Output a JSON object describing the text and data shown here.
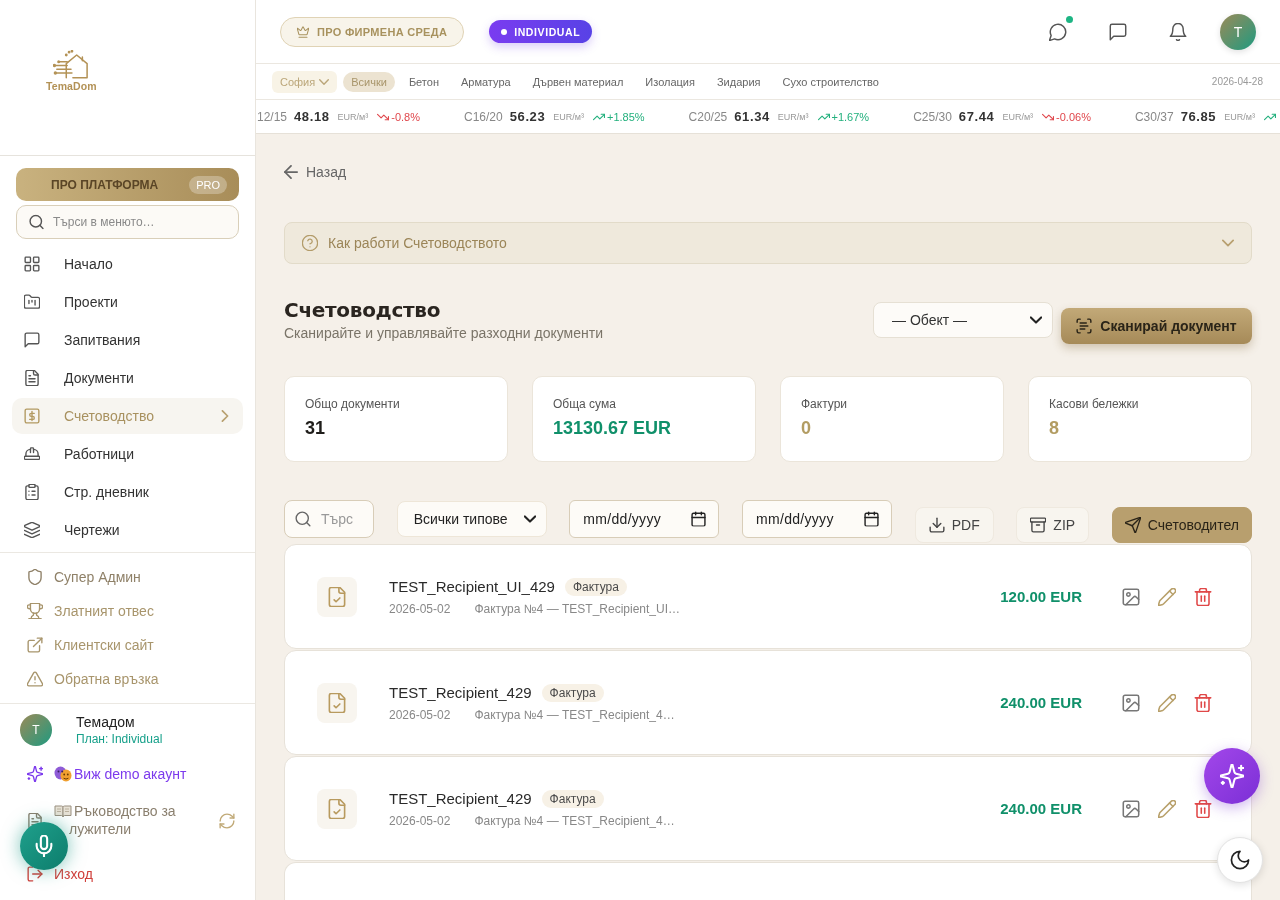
{
  "sidebar": {
    "logo": "TemaDom",
    "pro_button": {
      "label": "ПРО ПЛАТФОРМА",
      "badge": "PRO"
    },
    "search": {
      "placeholder": "Търси в менюто…"
    },
    "nav_items": [
      {
        "label": "Начало",
        "selected": false
      },
      {
        "label": "Проекти",
        "selected": false
      },
      {
        "label": "Запитвания",
        "selected": false
      },
      {
        "label": "Документи",
        "selected": false
      },
      {
        "label": "Счетоводство",
        "selected": true
      },
      {
        "label": "Работници",
        "selected": false
      },
      {
        "label": "Стр. дневник",
        "selected": false
      },
      {
        "label": "Чертежи",
        "selected": false
      }
    ],
    "admin_links": [
      {
        "label": "Супер Админ"
      },
      {
        "label": "Златният отвес"
      },
      {
        "label": "Клиентски сайт"
      },
      {
        "label": "Обратна връзка"
      }
    ],
    "user": {
      "initial": "T",
      "name": "Темадом",
      "plan": "План: Individual"
    },
    "footer_links": [
      {
        "kind": "demo",
        "label": "Виж demo акаунт"
      },
      {
        "kind": "guide",
        "label": "Ръководство за лужители"
      },
      {
        "kind": "logout",
        "label": "Изход"
      }
    ]
  },
  "header": {
    "badges": [
      {
        "kind": "pro",
        "label": "ПРО ФИРМЕНА СРЕДА"
      },
      {
        "kind": "plan",
        "label": "INDIVIDUAL"
      }
    ],
    "chat_unread": true,
    "avatar": "T"
  },
  "category_bar": {
    "city": "София",
    "categories": [
      {
        "label": "Всички",
        "selected": true
      },
      {
        "label": "Бетон",
        "selected": false
      },
      {
        "label": "Арматура",
        "selected": false
      },
      {
        "label": "Дървен материал",
        "selected": false
      },
      {
        "label": "Изолация",
        "selected": false
      },
      {
        "label": "Зидария",
        "selected": false
      },
      {
        "label": "Сухо строителство",
        "selected": false
      }
    ],
    "date": "2026-04-28"
  },
  "ticker": [
    {
      "grade": "12/15",
      "price": "48.18",
      "unit": "EUR/м³",
      "rising": false,
      "change": "-0.8%"
    },
    {
      "grade": "C16/20",
      "price": "56.23",
      "unit": "EUR/м³",
      "rising": true,
      "change": "+1.85%"
    },
    {
      "grade": "C20/25",
      "price": "61.34",
      "unit": "EUR/м³",
      "rising": true,
      "change": "+1.67%"
    },
    {
      "grade": "C25/30",
      "price": "67.44",
      "unit": "EUR/м³",
      "rising": false,
      "change": "-0.06%"
    },
    {
      "grade": "C30/37",
      "price": "76.85",
      "unit": "EUR/м³",
      "rising": true
    }
  ],
  "back_link": "Назад",
  "help_panel": {
    "title": "Как работи Счетоводството",
    "expanded": false
  },
  "page": {
    "title": "Счетоводство",
    "subtitle": "Сканирайте и управлявайте разходни документи",
    "object_select": "— Обект —",
    "scan_button": "Сканирай документ"
  },
  "stats": [
    {
      "label": "Общо документи",
      "value": "31",
      "color": "#1f1d1a"
    },
    {
      "label": "Обща сума",
      "value": "13130.67 EUR",
      "color": "#10906a"
    },
    {
      "label": "Фактури",
      "value": "0",
      "color": "#b29c62"
    },
    {
      "label": "Касови бележки",
      "value": "8",
      "color": "#b29c62"
    }
  ],
  "filters": {
    "search": {
      "placeholder": "Търс"
    },
    "type_select": "Всички типове",
    "date_from": {
      "placeholder": "mm/dd/yyyy"
    },
    "date_to": {
      "placeholder": "mm/dd/yyyy"
    },
    "buttons": [
      {
        "kind": "pdf",
        "label": "PDF"
      },
      {
        "kind": "zip",
        "label": "ZIP"
      },
      {
        "kind": "accountant",
        "label": "Счетоводител"
      }
    ]
  },
  "documents": [
    {
      "kind": "full",
      "title": "TEST_Recipient_UI_429",
      "type": "Фактура",
      "date": "2026-05-02",
      "description": "Фактура №4 — TEST_Recipient_UI…",
      "amount": "120.00 EUR"
    },
    {
      "kind": "full",
      "title": "TEST_Recipient_429",
      "type": "Фактура",
      "date": "2026-05-02",
      "description": "Фактура №4 — TEST_Recipient_4…",
      "amount": "240.00 EUR"
    },
    {
      "kind": "full",
      "title": "TEST_Recipient_429",
      "type": "Фактура",
      "date": "2026-05-02",
      "description": "Фактура №4 — TEST_Recipient_4…",
      "amount": "240.00 EUR"
    },
    {
      "kind": "cut"
    }
  ]
}
